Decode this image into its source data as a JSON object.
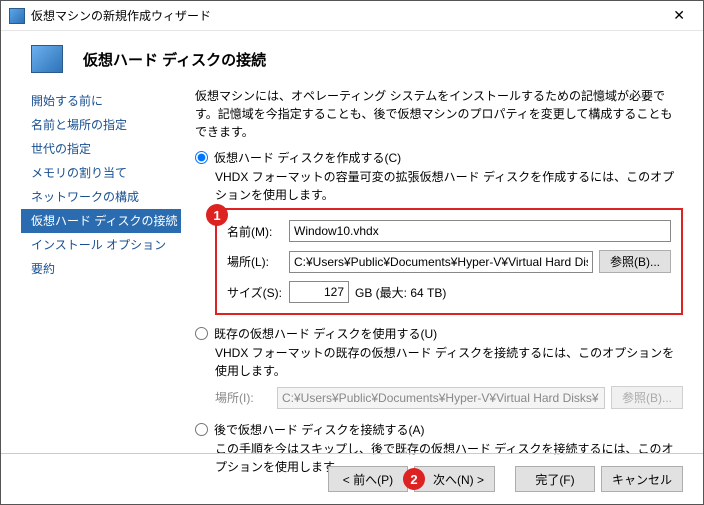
{
  "window": {
    "title": "仮想マシンの新規作成ウィザード",
    "close": "✕"
  },
  "header": {
    "title": "仮想ハード ディスクの接続"
  },
  "sidebar": {
    "items": [
      {
        "label": "開始する前に"
      },
      {
        "label": "名前と場所の指定"
      },
      {
        "label": "世代の指定"
      },
      {
        "label": "メモリの割り当て"
      },
      {
        "label": "ネットワークの構成"
      },
      {
        "label": "仮想ハード ディスクの接続"
      },
      {
        "label": "インストール オプション"
      },
      {
        "label": "要約"
      }
    ],
    "active_index": 5
  },
  "intro": "仮想マシンには、オペレーティング システムをインストールするための記憶域が必要です。記憶域を今指定することも、後で仮想マシンのプロパティを変更して構成することもできます。",
  "options": {
    "create": {
      "label": "仮想ハード ディスクを作成する(C)",
      "desc": "VHDX フォーマットの容量可変の拡張仮想ハード ディスクを作成するには、このオプションを使用します。",
      "name_label": "名前(M):",
      "name_value": "Window10.vhdx",
      "loc_label": "場所(L):",
      "loc_value": "C:¥Users¥Public¥Documents¥Hyper-V¥Virtual Hard Disks¥",
      "browse": "参照(B)...",
      "size_label": "サイズ(S):",
      "size_value": "127",
      "size_suffix": "GB (最大: 64 TB)"
    },
    "existing": {
      "label": "既存の仮想ハード ディスクを使用する(U)",
      "desc": "VHDX フォーマットの既存の仮想ハード ディスクを接続するには、このオプションを使用します。",
      "loc_label": "場所(I):",
      "loc_value": "C:¥Users¥Public¥Documents¥Hyper-V¥Virtual Hard Disks¥",
      "browse": "参照(B)..."
    },
    "later": {
      "label": "後で仮想ハード ディスクを接続する(A)",
      "desc": "この手順を今はスキップし、後で既存の仮想ハード ディスクを接続するには、このオプションを使用します。"
    }
  },
  "callouts": {
    "one": "1",
    "two": "2"
  },
  "footer": {
    "prev": "< 前へ(P)",
    "next": "次へ(N) >",
    "finish": "完了(F)",
    "cancel": "キャンセル"
  }
}
